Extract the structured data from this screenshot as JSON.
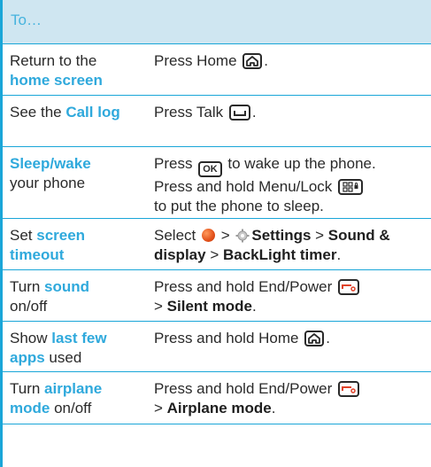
{
  "header": {
    "label": "To…"
  },
  "rows": [
    {
      "c1_plain_a": "Return to the ",
      "c1_hl": "home screen",
      "c2_a": "Press Home ",
      "c2_b": "."
    },
    {
      "c1_plain_a": "See the ",
      "c1_hl": "Call log",
      "c2_a": "Press Talk ",
      "c2_b": "."
    },
    {
      "c1_hl": "Sleep/wake",
      "c1_plain_b": "your phone",
      "c2_a": "Press ",
      "ok_label": "OK",
      "c2_b": " to wake up the phone.",
      "c2_c": "Press and hold Menu/Lock ",
      "c2_d": "to put the phone to sleep."
    },
    {
      "c1_plain_a": "Set ",
      "c1_hl": "screen timeout",
      "c2_a": "Select ",
      "sep1": " > ",
      "settings": "Settings",
      "sep2": " > ",
      "sound_display": "Sound & display",
      "sep3": " > ",
      "backlight": "BackLight timer",
      "end": "."
    },
    {
      "c1_plain_a": "Turn ",
      "c1_hl": "sound",
      "c1_plain_b": "on/off",
      "c2_a": "Press and hold End/Power ",
      "c2_b": "> ",
      "mode": "Silent mode",
      "end": "."
    },
    {
      "c1_plain_a": "Show ",
      "c1_hl": "last few apps",
      "c1_plain_b": " used",
      "c2_a": "Press and hold Home ",
      "c2_b": "."
    },
    {
      "c1_plain_a": "Turn ",
      "c1_hl": "airplane mode",
      "c1_plain_b": " on/off",
      "c2_a": "Press and hold End/Power ",
      "c2_b": "> ",
      "mode": "Airplane mode",
      "end": "."
    }
  ]
}
